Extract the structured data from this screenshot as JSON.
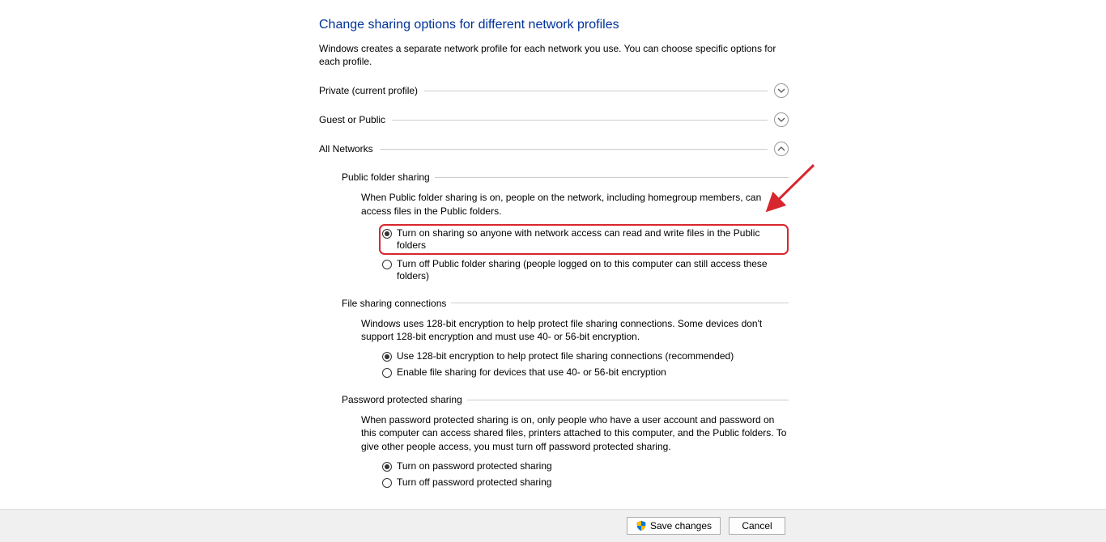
{
  "header": {
    "title": "Change sharing options for different network profiles",
    "intro": "Windows creates a separate network profile for each network you use. You can choose specific options for each profile."
  },
  "sections": {
    "private_label": "Private (current profile)",
    "guest_label": "Guest or Public",
    "all_label": "All Networks"
  },
  "public_folder": {
    "heading": "Public folder sharing",
    "desc": "When Public folder sharing is on, people on the network, including homegroup members, can access files in the Public folders.",
    "opt_on": "Turn on sharing so anyone with network access can read and write files in the Public folders",
    "opt_off": "Turn off Public folder sharing (people logged on to this computer can still access these folders)"
  },
  "file_sharing": {
    "heading": "File sharing connections",
    "desc": "Windows uses 128-bit encryption to help protect file sharing connections. Some devices don't support 128-bit encryption and must use 40- or 56-bit encryption.",
    "opt_128": "Use 128-bit encryption to help protect file sharing connections (recommended)",
    "opt_4056": "Enable file sharing for devices that use 40- or 56-bit encryption"
  },
  "password": {
    "heading": "Password protected sharing",
    "desc": "When password protected sharing is on, only people who have a user account and password on this computer can access shared files, printers attached to this computer, and the Public folders. To give other people access, you must turn off password protected sharing.",
    "opt_on": "Turn on password protected sharing",
    "opt_off": "Turn off password protected sharing"
  },
  "footer": {
    "save": "Save changes",
    "cancel": "Cancel"
  }
}
